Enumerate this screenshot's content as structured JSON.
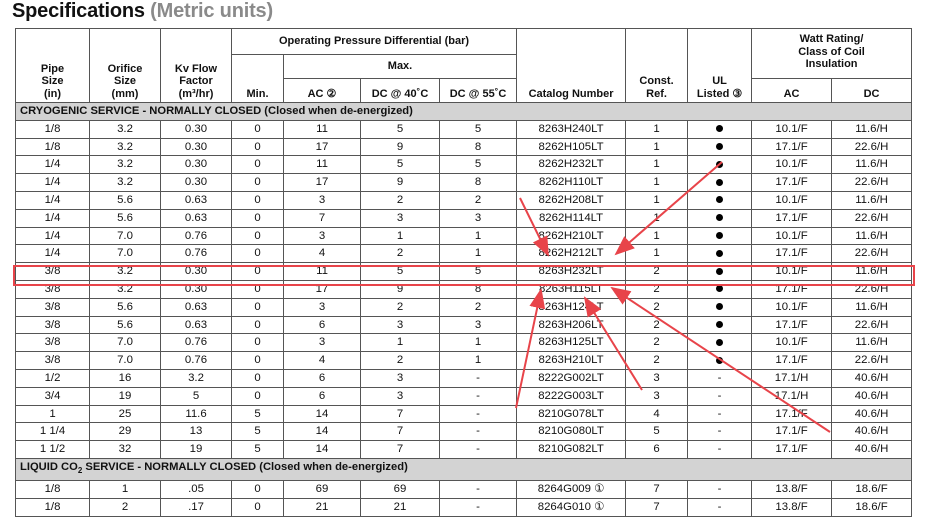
{
  "title": {
    "main": "Specifications",
    "sub": "(Metric units)"
  },
  "headers": {
    "pipe_size": [
      "Pipe",
      "Size",
      "(in)"
    ],
    "orifice": [
      "Orifice",
      "Size",
      "(mm)"
    ],
    "kv": [
      "Kv Flow",
      "Factor",
      "(m³/hr)"
    ],
    "opd_group": "Operating Pressure Differential (bar)",
    "min": "Min.",
    "max_group": "Max.",
    "ac": "AC ②",
    "dc40": "DC @ 40˚C",
    "dc55": "DC @ 55˚C",
    "catalog": "Catalog Number",
    "const_ref": [
      "Const.",
      "Ref."
    ],
    "ul": [
      "UL",
      "Listed ③"
    ],
    "watt_group": [
      "Watt Rating/",
      "Class of Coil",
      "Insulation"
    ],
    "watt_ac": "AC",
    "watt_dc": "DC"
  },
  "sections": [
    {
      "title": "CRYOGENIC SERVICE - NORMALLY CLOSED",
      "note": " (Closed when de-energized)",
      "rows": [
        [
          "1/8",
          "3.2",
          "0.30",
          "0",
          "11",
          "5",
          "5",
          "8263H240LT",
          "1",
          "dot",
          "10.1/F",
          "11.6/H"
        ],
        [
          "1/8",
          "3.2",
          "0.30",
          "0",
          "17",
          "9",
          "8",
          "8262H105LT",
          "1",
          "dot",
          "17.1/F",
          "22.6/H"
        ],
        [
          "1/4",
          "3.2",
          "0.30",
          "0",
          "11",
          "5",
          "5",
          "8262H232LT",
          "1",
          "dot",
          "10.1/F",
          "11.6/H"
        ],
        [
          "1/4",
          "3.2",
          "0.30",
          "0",
          "17",
          "9",
          "8",
          "8262H110LT",
          "1",
          "dot",
          "17.1/F",
          "22.6/H"
        ],
        [
          "1/4",
          "5.6",
          "0.63",
          "0",
          "3",
          "2",
          "2",
          "8262H208LT",
          "1",
          "dot",
          "10.1/F",
          "11.6/H"
        ],
        [
          "1/4",
          "5.6",
          "0.63",
          "0",
          "7",
          "3",
          "3",
          "8262H114LT",
          "1",
          "dot",
          "17.1/F",
          "22.6/H"
        ],
        [
          "1/4",
          "7.0",
          "0.76",
          "0",
          "3",
          "1",
          "1",
          "8262H210LT",
          "1",
          "dot",
          "10.1/F",
          "11.6/H"
        ],
        [
          "1/4",
          "7.0",
          "0.76",
          "0",
          "4",
          "2",
          "1",
          "8262H212LT",
          "1",
          "dot",
          "17.1/F",
          "22.6/H"
        ],
        [
          "3/8",
          "3.2",
          "0.30",
          "0",
          "11",
          "5",
          "5",
          "8263H232LT",
          "2",
          "dot",
          "10.1/F",
          "11.6/H"
        ],
        [
          "3/8",
          "3.2",
          "0.30",
          "0",
          "17",
          "9",
          "8",
          "8263H115LT",
          "2",
          "dot",
          "17.1/F",
          "22.6/H"
        ],
        [
          "3/8",
          "5.6",
          "0.63",
          "0",
          "3",
          "2",
          "2",
          "8263H124LT",
          "2",
          "dot",
          "10.1/F",
          "11.6/H"
        ],
        [
          "3/8",
          "5.6",
          "0.63",
          "0",
          "6",
          "3",
          "3",
          "8263H206LT",
          "2",
          "dot",
          "17.1/F",
          "22.6/H"
        ],
        [
          "3/8",
          "7.0",
          "0.76",
          "0",
          "3",
          "1",
          "1",
          "8263H125LT",
          "2",
          "dot",
          "10.1/F",
          "11.6/H"
        ],
        [
          "3/8",
          "7.0",
          "0.76",
          "0",
          "4",
          "2",
          "1",
          "8263H210LT",
          "2",
          "dot",
          "17.1/F",
          "22.6/H"
        ],
        [
          "1/2",
          "16",
          "3.2",
          "0",
          "6",
          "3",
          "-",
          "8222G002LT",
          "3",
          "-",
          "17.1/H",
          "40.6/H"
        ],
        [
          "3/4",
          "19",
          "5",
          "0",
          "6",
          "3",
          "-",
          "8222G003LT",
          "3",
          "-",
          "17.1/H",
          "40.6/H"
        ],
        [
          "1",
          "25",
          "11.6",
          "5",
          "14",
          "7",
          "-",
          "8210G078LT",
          "4",
          "-",
          "17.1/F",
          "40.6/H"
        ],
        [
          "1 1/4",
          "29",
          "13",
          "5",
          "14",
          "7",
          "-",
          "8210G080LT",
          "5",
          "-",
          "17.1/F",
          "40.6/H"
        ],
        [
          "1 1/2",
          "32",
          "19",
          "5",
          "14",
          "7",
          "-",
          "8210G082LT",
          "6",
          "-",
          "17.1/F",
          "40.6/H"
        ]
      ]
    },
    {
      "title_pre": "LIQUID CO",
      "title_sub": "2",
      "title_post": " SERVICE - NORMALLY CLOSED",
      "note": " (Closed when de-energized)",
      "rows": [
        [
          "1/8",
          "1",
          ".05",
          "0",
          "69",
          "69",
          "-",
          "8264G009 ①",
          "7",
          "-",
          "13.8/F",
          "18.6/F"
        ],
        [
          "1/8",
          "2",
          ".17",
          "0",
          "21",
          "21",
          "-",
          "8264G010 ①",
          "7",
          "-",
          "13.8/F",
          "18.6/F"
        ]
      ]
    }
  ],
  "annotation_color": "#e8444a"
}
